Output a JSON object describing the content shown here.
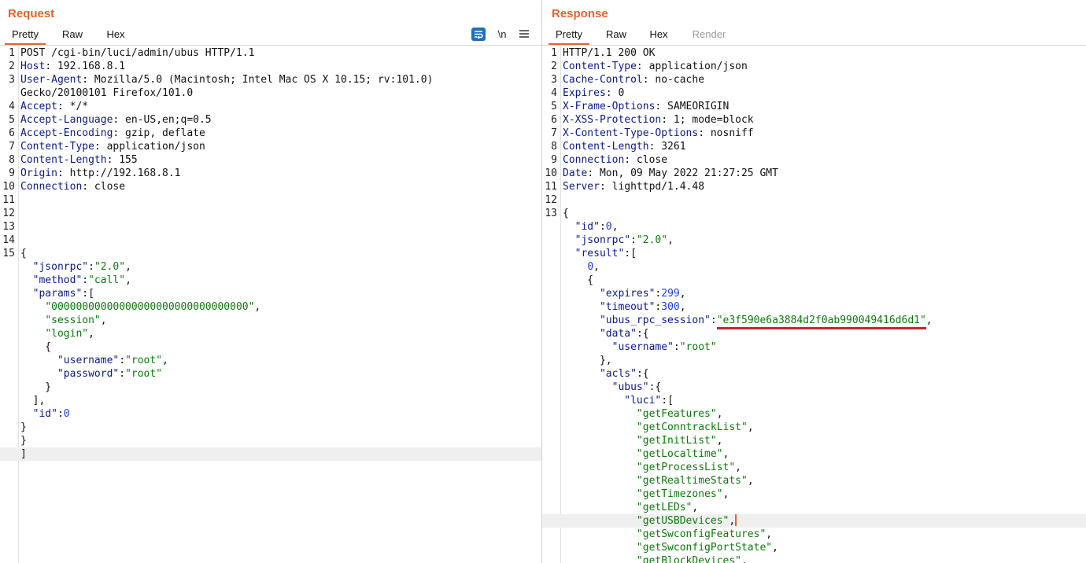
{
  "request": {
    "title": "Request",
    "tabs": [
      "Pretty",
      "Raw",
      "Hex"
    ],
    "active_tab": "Pretty",
    "tools": {
      "wrap_icon": "wrap-lines-icon",
      "newline_label": "\\n",
      "menu_icon": "hamburger-menu-icon"
    },
    "lines": [
      {
        "num": "1",
        "segs": [
          [
            "p",
            "POST /cgi-bin/luci/admin/ubus HTTP/1.1"
          ]
        ]
      },
      {
        "num": "2",
        "segs": [
          [
            "k",
            "Host"
          ],
          [
            "p",
            ": 192.168.8.1"
          ]
        ]
      },
      {
        "num": "3",
        "segs": [
          [
            "k",
            "User-Agent"
          ],
          [
            "p",
            ": Mozilla/5.0 (Macintosh; Intel Mac OS X 10.15; rv:101.0)"
          ]
        ]
      },
      {
        "num": "",
        "segs": [
          [
            "p",
            "Gecko/20100101 Firefox/101.0"
          ]
        ]
      },
      {
        "num": "4",
        "segs": [
          [
            "k",
            "Accept"
          ],
          [
            "p",
            ": */*"
          ]
        ]
      },
      {
        "num": "5",
        "segs": [
          [
            "k",
            "Accept-Language"
          ],
          [
            "p",
            ": en-US,en;q=0.5"
          ]
        ]
      },
      {
        "num": "6",
        "segs": [
          [
            "k",
            "Accept-Encoding"
          ],
          [
            "p",
            ": gzip, deflate"
          ]
        ]
      },
      {
        "num": "7",
        "segs": [
          [
            "k",
            "Content-Type"
          ],
          [
            "p",
            ": application/json"
          ]
        ]
      },
      {
        "num": "8",
        "segs": [
          [
            "k",
            "Content-Length"
          ],
          [
            "p",
            ": 155"
          ]
        ]
      },
      {
        "num": "9",
        "segs": [
          [
            "k",
            "Origin"
          ],
          [
            "p",
            ": http://192.168.8.1"
          ]
        ]
      },
      {
        "num": "10",
        "segs": [
          [
            "k",
            "Connection"
          ],
          [
            "p",
            ": close"
          ]
        ]
      },
      {
        "num": "11",
        "segs": []
      },
      {
        "num": "12",
        "segs": []
      },
      {
        "num": "13",
        "segs": []
      },
      {
        "num": "14",
        "segs": []
      },
      {
        "num": "15",
        "segs": [
          [
            "p",
            "{"
          ]
        ]
      },
      {
        "num": "",
        "segs": [
          [
            "p",
            "  "
          ],
          [
            "k",
            "\"jsonrpc\""
          ],
          [
            "p",
            ":"
          ],
          [
            "s",
            "\"2.0\""
          ],
          [
            "p",
            ","
          ]
        ]
      },
      {
        "num": "",
        "segs": [
          [
            "p",
            "  "
          ],
          [
            "k",
            "\"method\""
          ],
          [
            "p",
            ":"
          ],
          [
            "s",
            "\"call\""
          ],
          [
            "p",
            ","
          ]
        ]
      },
      {
        "num": "",
        "segs": [
          [
            "p",
            "  "
          ],
          [
            "k",
            "\"params\""
          ],
          [
            "p",
            ":["
          ]
        ]
      },
      {
        "num": "",
        "segs": [
          [
            "p",
            "    "
          ],
          [
            "s",
            "\"00000000000000000000000000000000\""
          ],
          [
            "p",
            ","
          ]
        ]
      },
      {
        "num": "",
        "segs": [
          [
            "p",
            "    "
          ],
          [
            "s",
            "\"session\""
          ],
          [
            "p",
            ","
          ]
        ]
      },
      {
        "num": "",
        "segs": [
          [
            "p",
            "    "
          ],
          [
            "s",
            "\"login\""
          ],
          [
            "p",
            ","
          ]
        ]
      },
      {
        "num": "",
        "segs": [
          [
            "p",
            "    {"
          ]
        ]
      },
      {
        "num": "",
        "segs": [
          [
            "p",
            "      "
          ],
          [
            "k",
            "\"username\""
          ],
          [
            "p",
            ":"
          ],
          [
            "s",
            "\"root\""
          ],
          [
            "p",
            ","
          ]
        ]
      },
      {
        "num": "",
        "segs": [
          [
            "p",
            "      "
          ],
          [
            "k",
            "\"password\""
          ],
          [
            "p",
            ":"
          ],
          [
            "s",
            "\"root\""
          ]
        ]
      },
      {
        "num": "",
        "segs": [
          [
            "p",
            "    }"
          ]
        ]
      },
      {
        "num": "",
        "segs": [
          [
            "p",
            "  ],"
          ]
        ]
      },
      {
        "num": "",
        "segs": [
          [
            "p",
            "  "
          ],
          [
            "k",
            "\"id\""
          ],
          [
            "p",
            ":"
          ],
          [
            "n",
            "0"
          ]
        ]
      },
      {
        "num": "",
        "segs": [
          [
            "p",
            "}"
          ]
        ]
      },
      {
        "num": "",
        "segs": [
          [
            "p",
            "}"
          ]
        ]
      },
      {
        "num": "",
        "segs": [
          [
            "p",
            "]"
          ]
        ],
        "hl": true
      }
    ]
  },
  "response": {
    "title": "Response",
    "tabs": [
      "Pretty",
      "Raw",
      "Hex",
      "Render"
    ],
    "active_tab": "Pretty",
    "disabled_tabs": [
      "Render"
    ],
    "lines": [
      {
        "num": "1",
        "segs": [
          [
            "p",
            "HTTP/1.1 200 OK"
          ]
        ]
      },
      {
        "num": "2",
        "segs": [
          [
            "k",
            "Content-Type"
          ],
          [
            "p",
            ": application/json"
          ]
        ]
      },
      {
        "num": "3",
        "segs": [
          [
            "k",
            "Cache-Control"
          ],
          [
            "p",
            ": no-cache"
          ]
        ]
      },
      {
        "num": "4",
        "segs": [
          [
            "k",
            "Expires"
          ],
          [
            "p",
            ": 0"
          ]
        ]
      },
      {
        "num": "5",
        "segs": [
          [
            "k",
            "X-Frame-Options"
          ],
          [
            "p",
            ": SAMEORIGIN"
          ]
        ]
      },
      {
        "num": "6",
        "segs": [
          [
            "k",
            "X-XSS-Protection"
          ],
          [
            "p",
            ": 1; mode=block"
          ]
        ]
      },
      {
        "num": "7",
        "segs": [
          [
            "k",
            "X-Content-Type-Options"
          ],
          [
            "p",
            ": nosniff"
          ]
        ]
      },
      {
        "num": "8",
        "segs": [
          [
            "k",
            "Content-Length"
          ],
          [
            "p",
            ": 3261"
          ]
        ]
      },
      {
        "num": "9",
        "segs": [
          [
            "k",
            "Connection"
          ],
          [
            "p",
            ": close"
          ]
        ]
      },
      {
        "num": "10",
        "segs": [
          [
            "k",
            "Date"
          ],
          [
            "p",
            ": Mon, 09 May 2022 21:27:25 GMT"
          ]
        ]
      },
      {
        "num": "11",
        "segs": [
          [
            "k",
            "Server"
          ],
          [
            "p",
            ": lighttpd/1.4.48"
          ]
        ]
      },
      {
        "num": "12",
        "segs": []
      },
      {
        "num": "13",
        "segs": [
          [
            "p",
            "{"
          ]
        ]
      },
      {
        "num": "",
        "segs": [
          [
            "p",
            "  "
          ],
          [
            "k",
            "\"id\""
          ],
          [
            "p",
            ":"
          ],
          [
            "n",
            "0"
          ],
          [
            "p",
            ","
          ]
        ]
      },
      {
        "num": "",
        "segs": [
          [
            "p",
            "  "
          ],
          [
            "k",
            "\"jsonrpc\""
          ],
          [
            "p",
            ":"
          ],
          [
            "s",
            "\"2.0\""
          ],
          [
            "p",
            ","
          ]
        ]
      },
      {
        "num": "",
        "segs": [
          [
            "p",
            "  "
          ],
          [
            "k",
            "\"result\""
          ],
          [
            "p",
            ":["
          ]
        ]
      },
      {
        "num": "",
        "segs": [
          [
            "p",
            "    "
          ],
          [
            "n",
            "0"
          ],
          [
            "p",
            ","
          ]
        ]
      },
      {
        "num": "",
        "segs": [
          [
            "p",
            "    {"
          ]
        ]
      },
      {
        "num": "",
        "segs": [
          [
            "p",
            "      "
          ],
          [
            "k",
            "\"expires\""
          ],
          [
            "p",
            ":"
          ],
          [
            "n",
            "299"
          ],
          [
            "p",
            ","
          ]
        ]
      },
      {
        "num": "",
        "segs": [
          [
            "p",
            "      "
          ],
          [
            "k",
            "\"timeout\""
          ],
          [
            "p",
            ":"
          ],
          [
            "n",
            "300"
          ],
          [
            "p",
            ","
          ]
        ]
      },
      {
        "num": "",
        "segs": [
          [
            "p",
            "      "
          ],
          [
            "k",
            "\"ubus_rpc_session\""
          ],
          [
            "p",
            ":"
          ],
          [
            "su",
            "\"e3f590e6a3884d2f0ab990049416d6d1\""
          ],
          [
            "p",
            ","
          ]
        ]
      },
      {
        "num": "",
        "segs": [
          [
            "p",
            "      "
          ],
          [
            "k",
            "\"data\""
          ],
          [
            "p",
            ":{"
          ]
        ]
      },
      {
        "num": "",
        "segs": [
          [
            "p",
            "        "
          ],
          [
            "k",
            "\"username\""
          ],
          [
            "p",
            ":"
          ],
          [
            "s",
            "\"root\""
          ]
        ]
      },
      {
        "num": "",
        "segs": [
          [
            "p",
            "      },"
          ]
        ]
      },
      {
        "num": "",
        "segs": [
          [
            "p",
            "      "
          ],
          [
            "k",
            "\"acls\""
          ],
          [
            "p",
            ":{"
          ]
        ]
      },
      {
        "num": "",
        "segs": [
          [
            "p",
            "        "
          ],
          [
            "k",
            "\"ubus\""
          ],
          [
            "p",
            ":{"
          ]
        ]
      },
      {
        "num": "",
        "segs": [
          [
            "p",
            "          "
          ],
          [
            "k",
            "\"luci\""
          ],
          [
            "p",
            ":["
          ]
        ]
      },
      {
        "num": "",
        "segs": [
          [
            "p",
            "            "
          ],
          [
            "s",
            "\"getFeatures\""
          ],
          [
            "p",
            ","
          ]
        ]
      },
      {
        "num": "",
        "segs": [
          [
            "p",
            "            "
          ],
          [
            "s",
            "\"getConntrackList\""
          ],
          [
            "p",
            ","
          ]
        ]
      },
      {
        "num": "",
        "segs": [
          [
            "p",
            "            "
          ],
          [
            "s",
            "\"getInitList\""
          ],
          [
            "p",
            ","
          ]
        ]
      },
      {
        "num": "",
        "segs": [
          [
            "p",
            "            "
          ],
          [
            "s",
            "\"getLocaltime\""
          ],
          [
            "p",
            ","
          ]
        ]
      },
      {
        "num": "",
        "segs": [
          [
            "p",
            "            "
          ],
          [
            "s",
            "\"getProcessList\""
          ],
          [
            "p",
            ","
          ]
        ]
      },
      {
        "num": "",
        "segs": [
          [
            "p",
            "            "
          ],
          [
            "s",
            "\"getRealtimeStats\""
          ],
          [
            "p",
            ","
          ]
        ]
      },
      {
        "num": "",
        "segs": [
          [
            "p",
            "            "
          ],
          [
            "s",
            "\"getTimezones\""
          ],
          [
            "p",
            ","
          ]
        ]
      },
      {
        "num": "",
        "segs": [
          [
            "p",
            "            "
          ],
          [
            "s",
            "\"getLEDs\""
          ],
          [
            "p",
            ","
          ]
        ]
      },
      {
        "num": "",
        "segs": [
          [
            "p",
            "            "
          ],
          [
            "s",
            "\"getUSBDevices\""
          ],
          [
            "p",
            ","
          ],
          [
            "cur",
            ""
          ]
        ],
        "hl": true
      },
      {
        "num": "",
        "segs": [
          [
            "p",
            "            "
          ],
          [
            "s",
            "\"getSwconfigFeatures\""
          ],
          [
            "p",
            ","
          ]
        ]
      },
      {
        "num": "",
        "segs": [
          [
            "p",
            "            "
          ],
          [
            "s",
            "\"getSwconfigPortState\""
          ],
          [
            "p",
            ","
          ]
        ]
      },
      {
        "num": "",
        "segs": [
          [
            "p",
            "            "
          ],
          [
            "s",
            "\"getBlockDevices\""
          ],
          [
            "p",
            ","
          ]
        ]
      }
    ]
  }
}
